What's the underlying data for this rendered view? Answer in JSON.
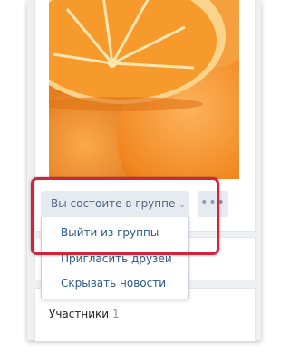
{
  "group": {
    "status_button_label": "Вы состоите в группе",
    "more_button_label": "•••",
    "dropdown": {
      "items": [
        {
          "label": "Выйти из группы"
        },
        {
          "label": "Пригласить друзей"
        },
        {
          "label": "Скрывать новости"
        }
      ]
    }
  },
  "members": {
    "label": "Участники",
    "count": "1"
  },
  "colors": {
    "link": "#2a5885",
    "button_bg": "#e5ebf1",
    "highlight": "#d0253a",
    "orange": "#f28a22"
  }
}
